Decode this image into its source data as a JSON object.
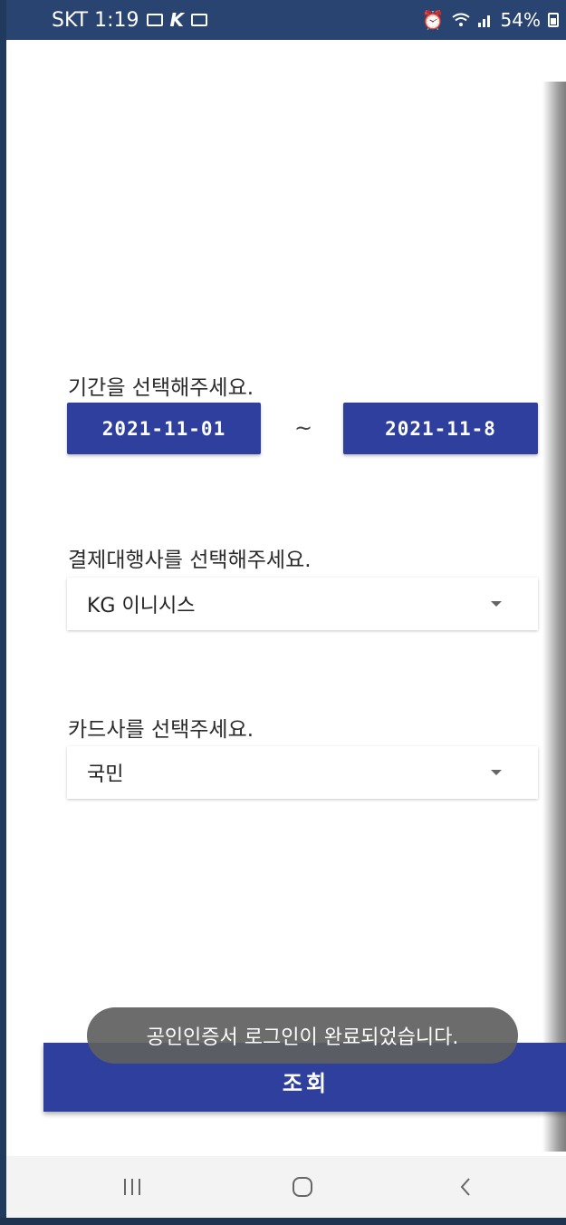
{
  "status_bar": {
    "carrier_time": "SKT 1:19",
    "icons_left": [
      "gallery-icon",
      "k-app-icon",
      "message-icon"
    ],
    "icons_right": [
      "alarm-icon",
      "wifi-icon",
      "signal-icon",
      "battery-icon"
    ],
    "battery": "54%"
  },
  "period": {
    "label": "기간을 선택해주세요.",
    "start_date": "2021-11-01",
    "separator": "~",
    "end_date": "2021-11-8"
  },
  "pg": {
    "label": "결제대행사를 선택해주세요.",
    "selected": "KG 이니시스"
  },
  "card": {
    "label": "카드사를 선택주세요.",
    "selected": "국민"
  },
  "query_button": "조회",
  "toast": "공인인증서 로그인이 완료되었습니다.",
  "colors": {
    "primary": "#2f3f9e",
    "status_bar": "#2a4472",
    "toast": "#5f5f5f"
  }
}
